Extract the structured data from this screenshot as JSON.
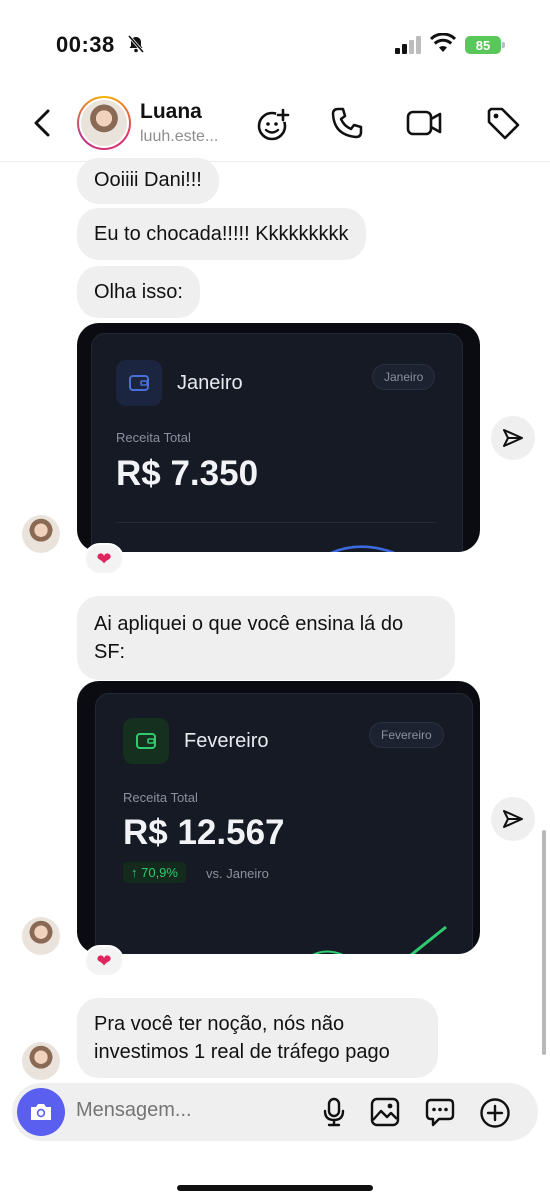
{
  "status_bar": {
    "time": "00:38",
    "battery": "85"
  },
  "header": {
    "name": "Luana",
    "username": "luuh.este..."
  },
  "messages": {
    "m1": "Ooiiii Dani!!!",
    "m2": "Eu to chocada!!!!! Kkkkkkkkk",
    "m3": "Olha isso:",
    "card1": {
      "month": "Janeiro",
      "pill": "Janeiro",
      "label": "Receita Total",
      "amount": "R$ 7.350"
    },
    "m4_line1": "Ai apliquei o que você ensina lá do",
    "m4_line2": "SF:",
    "card2": {
      "month": "Fevereiro",
      "pill": "Fevereiro",
      "label": "Receita Total",
      "amount": "R$ 12.567",
      "change": "↑ 70,9%",
      "compare": "vs. Janeiro"
    },
    "m5_line1": "Pra você ter noção, nós não",
    "m5_line2": "investimos 1 real de tráfego pago",
    "reaction": "❤"
  },
  "composer": {
    "placeholder": "Mensagem..."
  },
  "colors": {
    "accent": "#5b5ff0",
    "bubble": "#efeff0",
    "card": "#0a0c12",
    "positive": "#2ecc71"
  },
  "icons": [
    "bell-slash-icon",
    "signal-icon",
    "wifi-icon",
    "back-chevron-icon",
    "sticker-add-icon",
    "phone-icon",
    "video-icon",
    "tag-icon",
    "share-icon",
    "camera-icon",
    "mic-icon",
    "gallery-icon",
    "chat-icon",
    "plus-icon",
    "wallet-icon"
  ]
}
